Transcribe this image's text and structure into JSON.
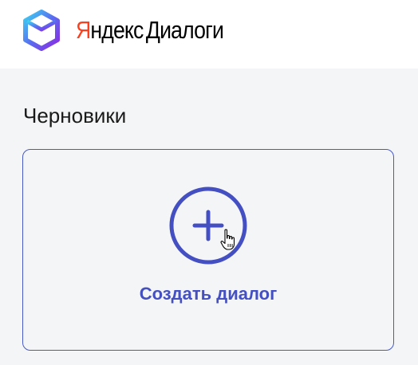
{
  "header": {
    "brand_red": "Я",
    "brand_rest": "ндекс",
    "product": "Диалоги",
    "logo_icon": "cube-logo-icon"
  },
  "drafts": {
    "title": "Черновики",
    "create_card": {
      "label": "Создать диалог",
      "icon": "plus-icon"
    }
  },
  "colors": {
    "accent": "#4450c1",
    "brand_red": "#fc3f1d",
    "background": "#f4f5f7",
    "header_bg": "#ffffff"
  }
}
